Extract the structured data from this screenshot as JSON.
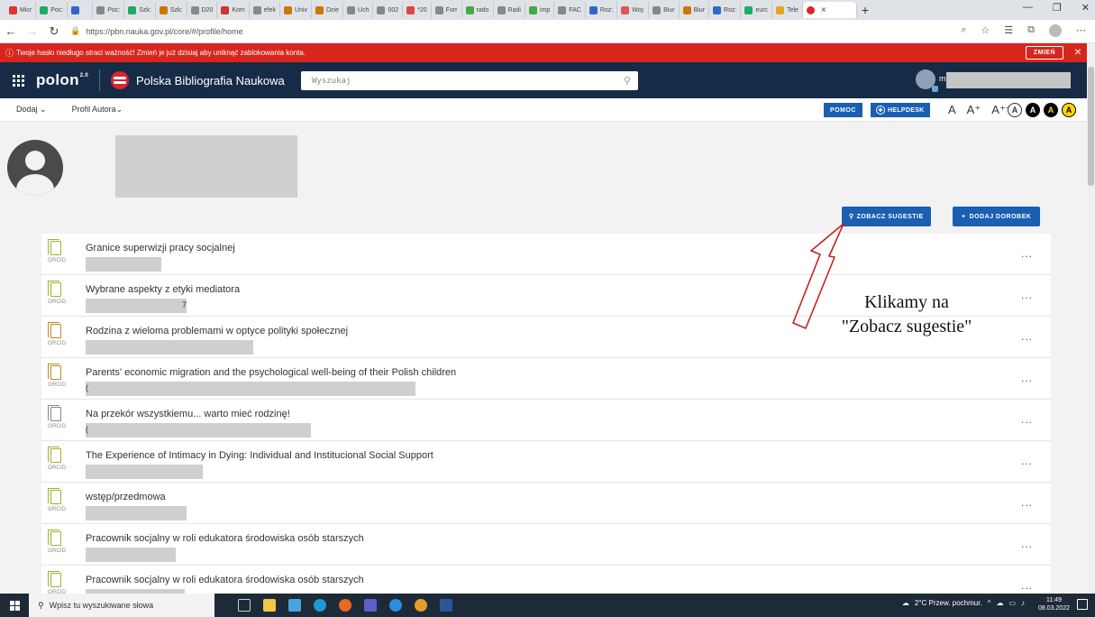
{
  "browser": {
    "tabs": [
      {
        "label": "Micr"
      },
      {
        "label": "Poc:"
      },
      {
        "label": ""
      },
      {
        "label": "Poc:"
      },
      {
        "label": "Szk:"
      },
      {
        "label": "Szk:"
      },
      {
        "label": "D20"
      },
      {
        "label": "Kom"
      },
      {
        "label": "efek"
      },
      {
        "label": "Univ"
      },
      {
        "label": "Dzie"
      },
      {
        "label": "Uch"
      },
      {
        "label": "002"
      },
      {
        "label": "*20"
      },
      {
        "label": "Forr"
      },
      {
        "label": "rado"
      },
      {
        "label": "Radi"
      },
      {
        "label": "imp"
      },
      {
        "label": "FAC"
      },
      {
        "label": "Roz:"
      },
      {
        "label": "Woj:"
      },
      {
        "label": "Biur"
      },
      {
        "label": "Biur"
      },
      {
        "label": "Roz:"
      },
      {
        "label": "eurc"
      },
      {
        "label": "Tele"
      }
    ],
    "active_tab_close": "×",
    "new_tab": "+",
    "url": "https://pbn.nauka.gov.pl/core/#/profile/home"
  },
  "warning": {
    "message": "Twoje hasło niedługo straci ważność! Zmień je już dzisiaj aby uniknąć zablokowania konta.",
    "button": "ZMIEŃ",
    "close": "×"
  },
  "header": {
    "brand": "polon",
    "brand_version": "2.0",
    "app_title": "Polska Bibliografia Naukowa",
    "search_placeholder": "Wyszukaj",
    "user_initial": "m"
  },
  "subnav": {
    "add": "Dodaj",
    "author_profile": "Profil Autora",
    "help": "POMOC",
    "helpdesk": "HELPDESK",
    "font_small": "A",
    "font_medium": "A⁺",
    "font_large": "A⁺⁺",
    "contrast": [
      "A",
      "A",
      "A",
      "A"
    ]
  },
  "profile": {
    "see_suggestions": "ZOBACZ SUGESTIE",
    "add_work": "DODAJ DOROBEK"
  },
  "publications": [
    {
      "title": "Granice superwizji pracy socjalnej",
      "detail": ""
    },
    {
      "title": "Wybrane aspekty z etyki mediatora",
      "detail": "7"
    },
    {
      "title": "Rodzina z wieloma problemami w optyce polityki społecznej",
      "detail": ""
    },
    {
      "title": "Parents' economic migration and the psychological well-being of their Polish children",
      "detail": "("
    },
    {
      "title": "Na przekór wszystkiemu... warto mieć rodzinę!",
      "detail": "("
    },
    {
      "title": "The Experience of Intimacy in Dying: Individual and Institucional Social Support",
      "detail": ""
    },
    {
      "title": "wstęp/przedmowa",
      "detail": ""
    },
    {
      "title": "Pracownik socjalny w roli edukatora środowiska osób starszych",
      "detail": ""
    },
    {
      "title": "Pracownik socjalny w roli edukatora środowiska osób starszych",
      "detail": ""
    }
  ],
  "orcid_label": "ORCID",
  "more_label": "...",
  "annotation": {
    "line1": "Klikamy na",
    "line2": "\"Zobacz sugestie\""
  },
  "taskbar": {
    "search_placeholder": "Wpisz tu wyszukiwane słowa",
    "weather": "2°C Przew. pochmur.",
    "time": "11:49",
    "date": "08.03.2022"
  }
}
